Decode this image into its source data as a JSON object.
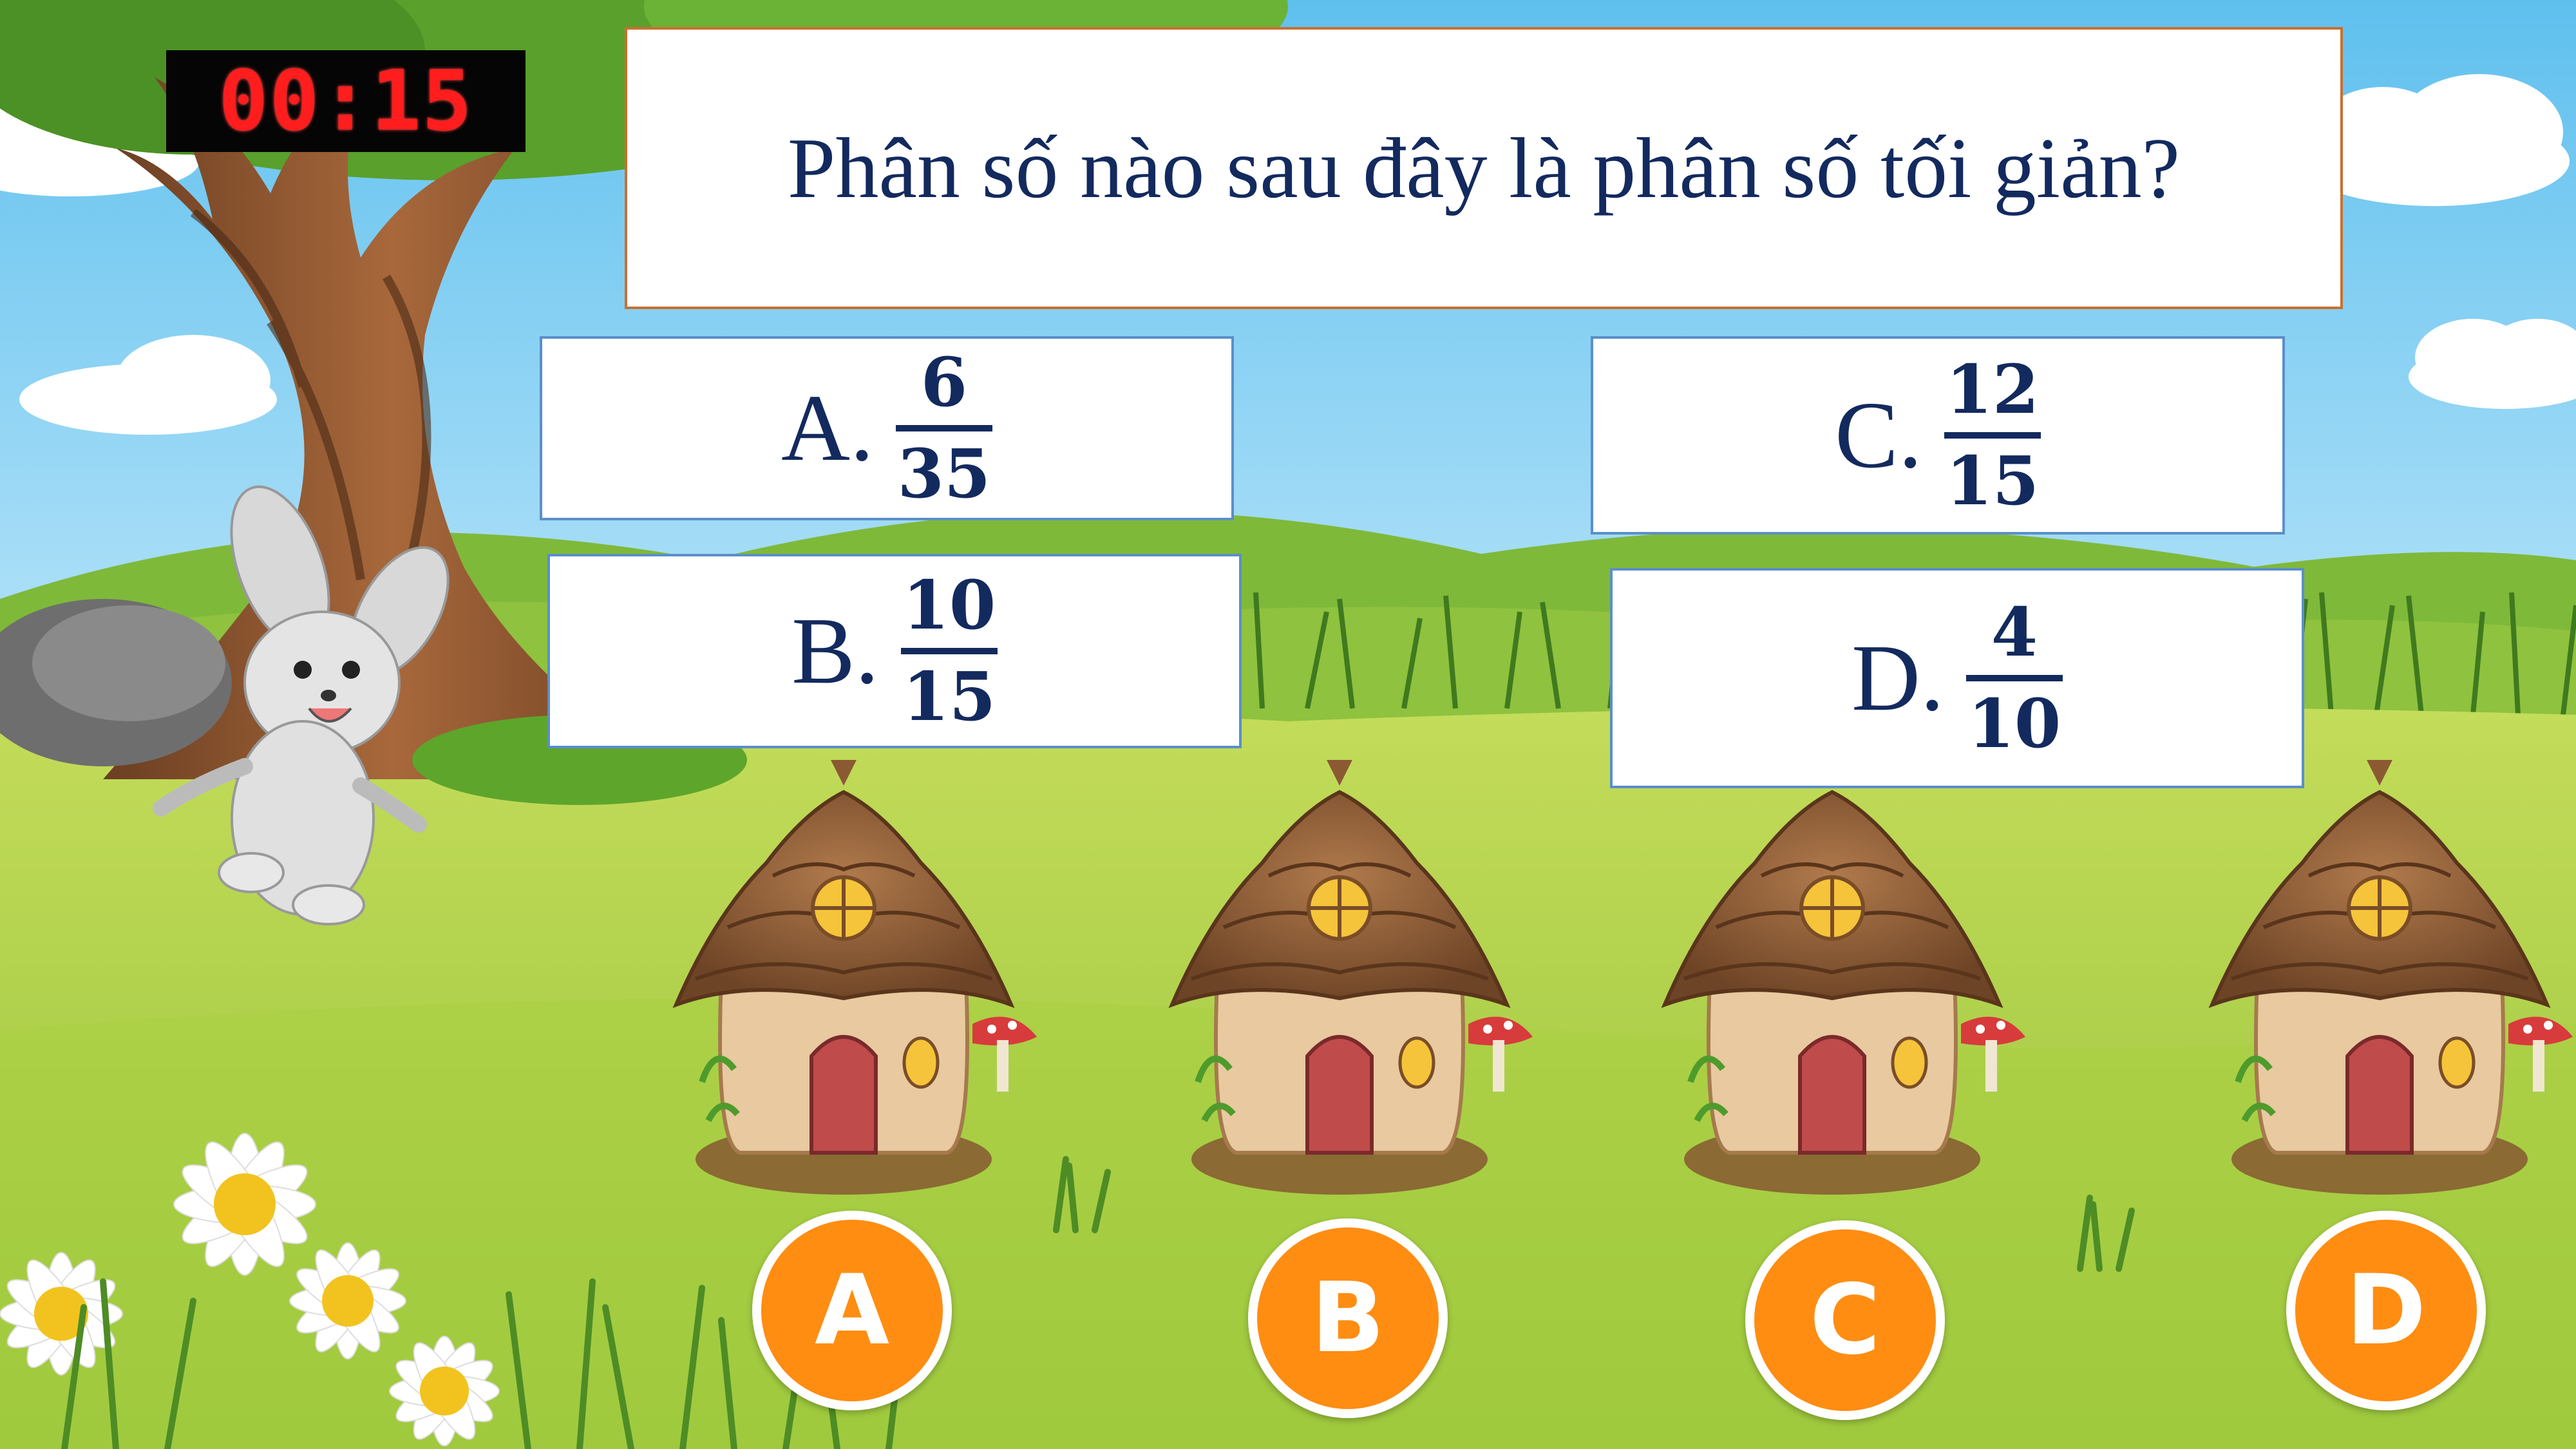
{
  "timer": {
    "text": "00:15"
  },
  "question": {
    "text": "Phân số nào sau đây là phân số tối giản?"
  },
  "answers": [
    {
      "letter": "A.",
      "numerator": "6",
      "denominator": "35"
    },
    {
      "letter": "B.",
      "numerator": "10",
      "denominator": "15"
    },
    {
      "letter": "C.",
      "numerator": "12",
      "denominator": "15"
    },
    {
      "letter": "D.",
      "numerator": "4",
      "denominator": "10"
    }
  ],
  "choices": [
    {
      "label": "A"
    },
    {
      "label": "B"
    },
    {
      "label": "C"
    },
    {
      "label": "D"
    }
  ],
  "colors": {
    "sky": "#6fc7ef",
    "grass": "#a9d14a",
    "choice_button": "#ff8d12",
    "question_text": "#132a5e",
    "timer_digits": "#ff1d1d"
  }
}
